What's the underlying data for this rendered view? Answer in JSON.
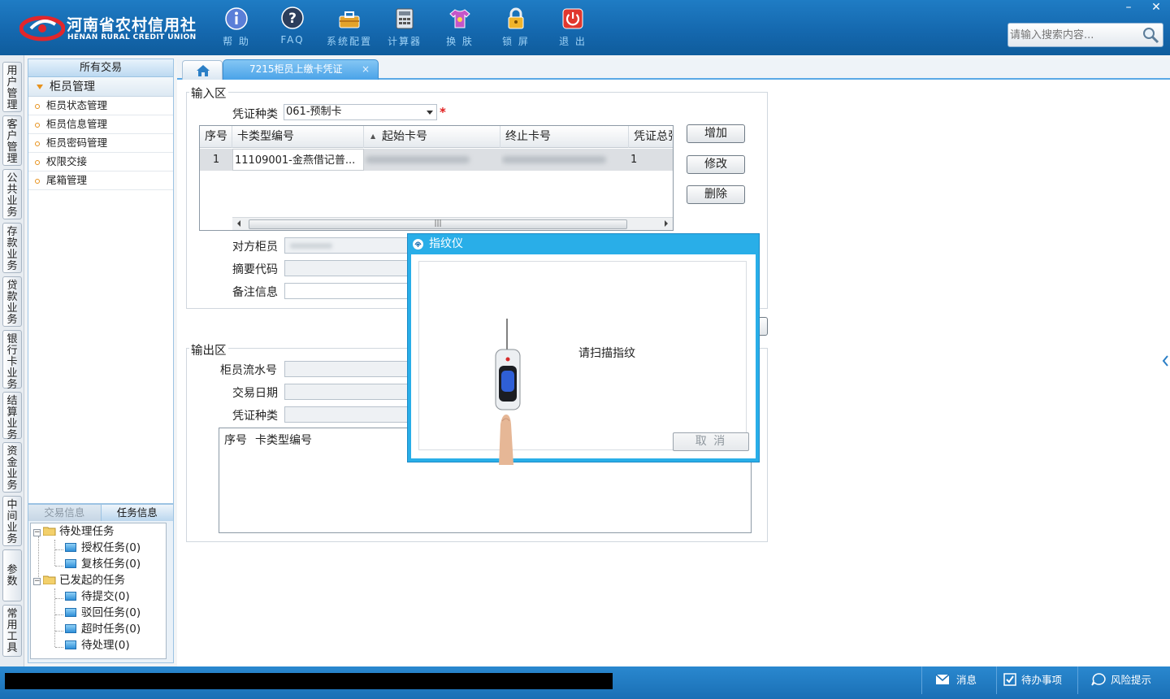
{
  "brand": {
    "name_cn": "河南省农村信用社",
    "name_en": "HENAN RURAL CREDIT UNION"
  },
  "toolbar": [
    {
      "label": "帮 助",
      "icon": "help-icon"
    },
    {
      "label": "FAQ",
      "icon": "faq-icon"
    },
    {
      "label": "系统配置",
      "icon": "toolbox-icon"
    },
    {
      "label": "计算器",
      "icon": "calculator-icon"
    },
    {
      "label": "换 肤",
      "icon": "shirt-icon"
    },
    {
      "label": "锁 屏",
      "icon": "lock-icon"
    },
    {
      "label": "退 出",
      "icon": "power-icon"
    }
  ],
  "window_controls": {
    "minimize": "–",
    "close": "✕"
  },
  "search": {
    "placeholder": "请输入搜索内容..."
  },
  "vertical_tabs": [
    "用户管理",
    "客户管理",
    "公共业务",
    "存款业务",
    "贷款业务",
    "银行卡业务",
    "结算业务",
    "资金业务",
    "中间业务",
    "参数",
    "常用工具"
  ],
  "nav": {
    "header": "所有交易",
    "group": "柜员管理",
    "items": [
      "柜员状态管理",
      "柜员信息管理",
      "柜员密码管理",
      "权限交接",
      "尾箱管理"
    ]
  },
  "task_panel": {
    "tabs": [
      "交易信息",
      "任务信息"
    ],
    "tree": {
      "pending": "待处理任务",
      "authorize": "授权任务(0)",
      "review": "复核任务(0)",
      "initiated": "已发起的任务",
      "to_submit": "待提交(0)",
      "rejected": "驳回任务(0)",
      "timeout": "超时任务(0)",
      "to_process": "待处理(0)"
    }
  },
  "tabs": {
    "home_icon": "home-icon",
    "current": "7215柜员上缴卡凭证",
    "close": "×"
  },
  "input_zone": {
    "title": "输入区",
    "voucher_type_label": "凭证种类",
    "voucher_type_value": "061-预制卡",
    "required_mark": "*",
    "grid": {
      "columns": [
        "序号",
        "卡类型编号",
        "起始卡号",
        "终止卡号",
        "凭证总张"
      ],
      "rows": [
        {
          "seq": "1",
          "card_type": "11109001-金燕借记普...",
          "start_card": "",
          "end_card": "",
          "total": "1"
        }
      ]
    },
    "buttons": {
      "add": "增加",
      "modify": "修改",
      "delete": "删除"
    },
    "counterpart_teller_label": "对方柜员",
    "summary_code_label": "摘要代码",
    "remarks_label": "备注信息"
  },
  "output_zone": {
    "title": "输出区",
    "teller_serial_label": "柜员流水号",
    "trade_date_label": "交易日期",
    "voucher_type_label": "凭证种类",
    "grid_columns": [
      "序号",
      "卡类型编号"
    ]
  },
  "modal": {
    "title": "指纹仪",
    "message": "请扫描指纹",
    "cancel": "取 消"
  },
  "statusbar": {
    "message": "消息",
    "todo": "待办事项",
    "risk": "风险提示"
  },
  "colors": {
    "topbar": "#1467ad",
    "accent": "#29aee8",
    "orange": "#e7921c",
    "required": "#e11d1d"
  }
}
